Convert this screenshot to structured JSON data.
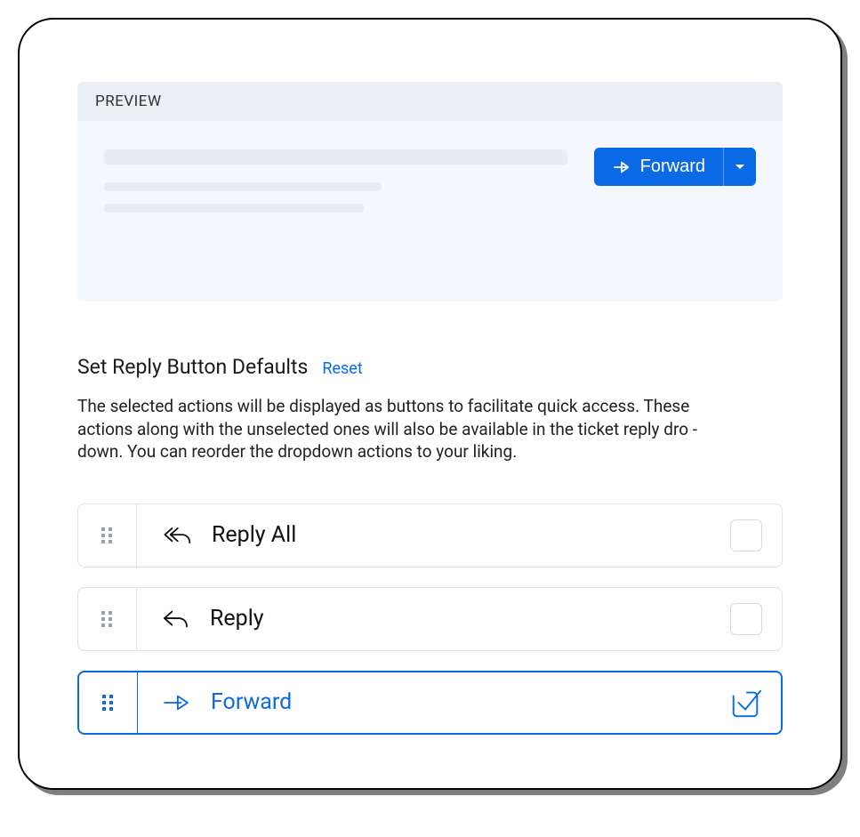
{
  "preview": {
    "header_label": "PREVIEW",
    "forward_button_label": "Forward"
  },
  "defaults": {
    "title": "Set Reply Button Defaults",
    "reset_label": "Reset",
    "description": "The selected actions will be displayed as buttons to facilitate quick access. These actions along with the unselected ones will also be available in the ticket reply dro   - down. You can reorder the dropdown actions to your liking."
  },
  "actions": [
    {
      "label": "Reply All",
      "selected": false,
      "icon": "reply-all"
    },
    {
      "label": "Reply",
      "selected": false,
      "icon": "reply"
    },
    {
      "label": "Forward",
      "selected": true,
      "icon": "forward"
    }
  ],
  "colors": {
    "accent": "#0a6ae6"
  }
}
